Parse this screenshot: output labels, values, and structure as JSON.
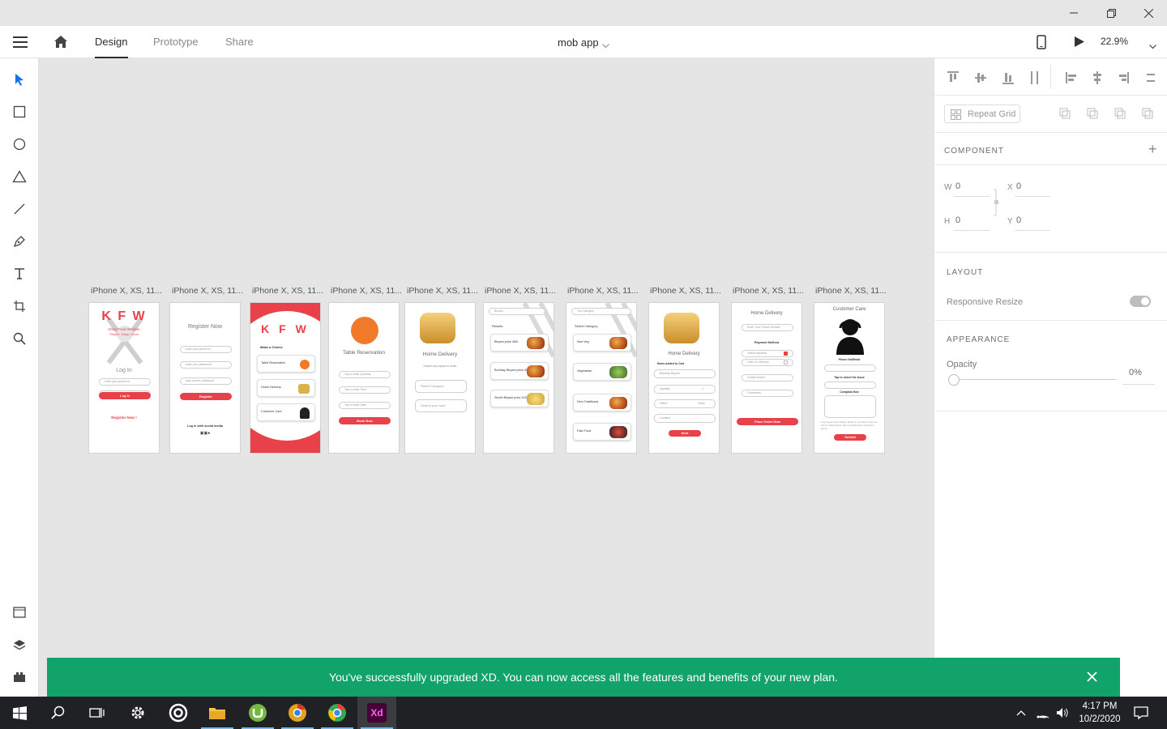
{
  "window": {
    "minimize_icon": "minimize-icon",
    "maximize_icon": "restore-icon",
    "close_icon": "close-icon"
  },
  "appbar": {
    "tabs": [
      {
        "label": "Design",
        "active": true
      },
      {
        "label": "Prototype",
        "active": false
      },
      {
        "label": "Share",
        "active": false
      }
    ],
    "document_title": "mob app",
    "zoom": "22.9%"
  },
  "tools": [
    "select-icon",
    "rectangle-icon",
    "ellipse-icon",
    "polygon-icon",
    "line-icon",
    "pen-icon",
    "text-icon",
    "artboard-icon",
    "zoom-icon"
  ],
  "bottom_tools": [
    "assets-icon",
    "layers-icon",
    "plugins-icon"
  ],
  "artboards": [
    {
      "label": "iPhone X, XS, 11...",
      "screen": "login",
      "title": "K F W",
      "subtitle": "Khan Food Wonder",
      "subtitle2": "Simple, Tasty, Good",
      "heading": "Log In",
      "fields": [
        "enter your phone no",
        "enter your password"
      ],
      "button": "Log in",
      "link": "Register Now !"
    },
    {
      "label": "iPhone X, XS, 11...",
      "screen": "register",
      "heading": "Register Now",
      "fields": [
        "enter your phone no",
        "enter your password",
        "type confirm password"
      ],
      "button": "Register",
      "footer": "Log in with social media"
    },
    {
      "label": "iPhone X, XS, 11...",
      "screen": "choice",
      "title": "K F W",
      "heading": "Make a Choice",
      "options": [
        "Table Reservation",
        "Home Delivery",
        "Customer Care"
      ]
    },
    {
      "label": "iPhone X, XS, 11...",
      "screen": "table",
      "heading": "Table Reservation",
      "fields": [
        "Tap to enter Quantity",
        "Tap to enter Time",
        "Tap to enter Date"
      ],
      "button": "Book Now"
    },
    {
      "label": "iPhone X, XS, 11...",
      "screen": "delivery",
      "heading": "Home Delivery",
      "subheading": "Search any option to order",
      "fields": [
        "Select Category",
        "Search your food"
      ]
    },
    {
      "label": "iPhone X, XS, 11...",
      "screen": "results",
      "search": "Biryani",
      "heading": "Results",
      "items": [
        "Biryani price 450/-",
        "Bombay Biryani price 450/-",
        "Sindhi Biryani price 420/-"
      ]
    },
    {
      "label": "iPhone X, XS, 11...",
      "screen": "category",
      "search": "Top Category",
      "heading": "Select Category",
      "items": [
        "Non Veg",
        "Vegetarian",
        "Desi Traditional",
        "Fast Food"
      ]
    },
    {
      "label": "iPhone X, XS, 11...",
      "screen": "cart",
      "heading": "Home Delivery",
      "subheading": "Items Added to Cart",
      "fields": [
        "Bombay Biryani",
        "Quantity",
        "Offers",
        "Location"
      ],
      "quantity": "1",
      "offer": "None",
      "button": "Next"
    },
    {
      "label": "iPhone X, XS, 11...",
      "screen": "order",
      "heading": "Home Delivery",
      "fields": [
        "Enter Your Phone Number"
      ],
      "payment_heading": "Payment Method",
      "payments": [
        "online payment",
        "Cash on Delivery"
      ],
      "more": [
        "Credit number",
        "Comments"
      ],
      "button": "Place Order Now"
    },
    {
      "label": "iPhone X, XS, 11...",
      "screen": "care",
      "heading": "Customer Care",
      "fields": [
        "Phone No/Email",
        "Tap to select the Issue"
      ],
      "box_label": "Complain Box",
      "note": "Any issues and problem faced by our dear customer can be submitted to the complaint box mentioned above",
      "button": "Submit"
    }
  ],
  "panel": {
    "repeat_grid": "Repeat Grid",
    "component": "COMPONENT",
    "w_label": "W",
    "w": "0",
    "x_label": "X",
    "x": "0",
    "h_label": "H",
    "h": "0",
    "y_label": "Y",
    "y": "0",
    "layout": "LAYOUT",
    "responsive": "Responsive Resize",
    "appearance": "APPEARANCE",
    "opacity_label": "Opacity",
    "opacity": "0%"
  },
  "toast": {
    "message": "You've successfully upgraded XD. You can now access all the features and benefits of your new plan."
  },
  "taskbar": {
    "time": "4:17 PM",
    "date": "10/2/2020"
  },
  "colors": {
    "accent": "#e8414a",
    "toast": "#12a36a",
    "xd": "#470137"
  }
}
